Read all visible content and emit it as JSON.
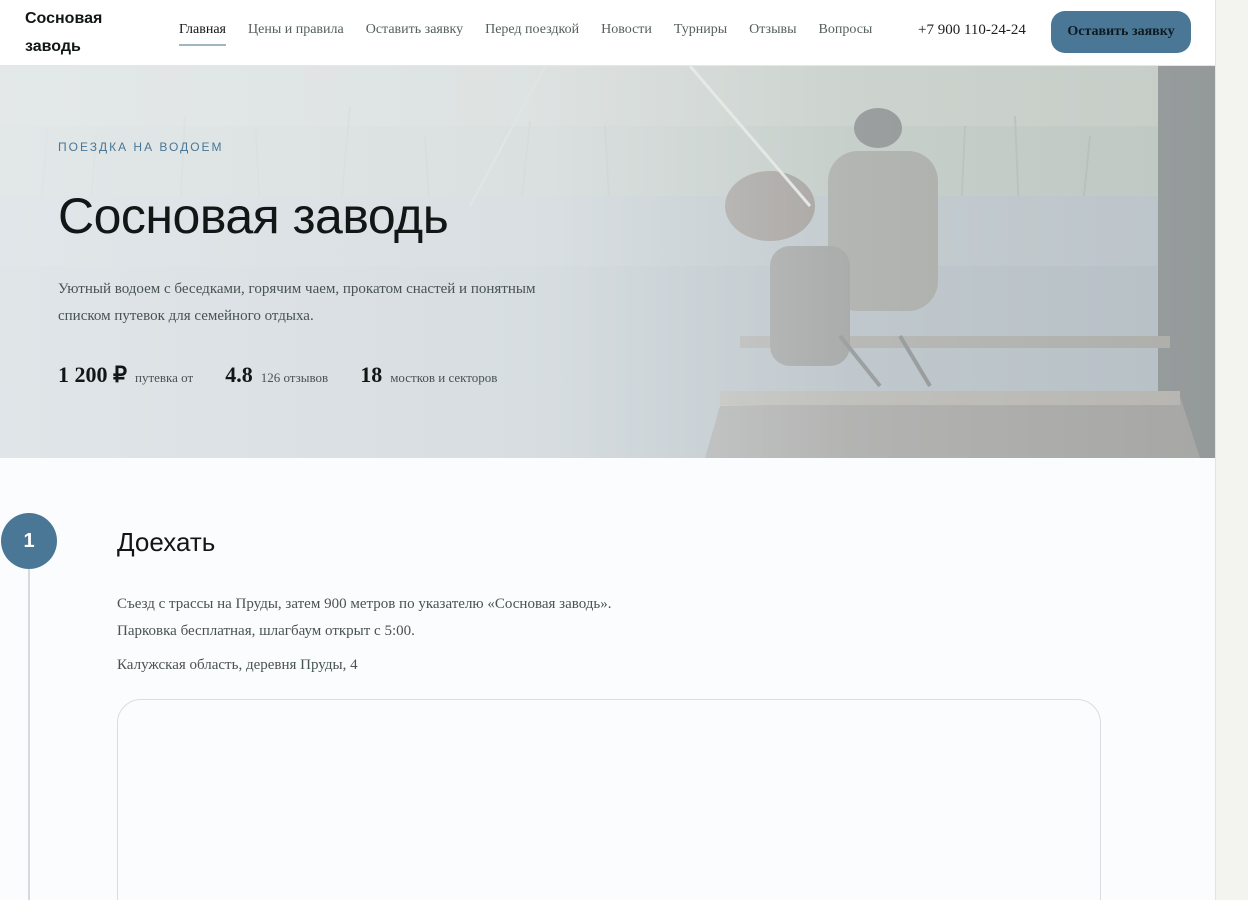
{
  "header": {
    "logo_line1": "Сосновая",
    "logo_line2": "заводь",
    "nav": [
      {
        "label": "Главная"
      },
      {
        "label": "Цены и правила"
      },
      {
        "label": "Оставить заявку"
      },
      {
        "label": "Перед поездкой"
      },
      {
        "label": "Новости"
      },
      {
        "label": "Турниры"
      },
      {
        "label": "Отзывы"
      },
      {
        "label": "Вопросы"
      }
    ],
    "active_nav": "Главная",
    "phone": "+7 900 110-24-24",
    "cta_label": "Оставить заявку"
  },
  "hero": {
    "eyebrow": "Поездка на водоем",
    "title": "Сосновая заводь",
    "description_line1": "Уютный водоем с беседками, горячим чаем, прокатом снастей и понятным",
    "description_line2": "списком путевок для семейного отдыха.",
    "stats": [
      {
        "value": "1 200 ₽",
        "label": "путевка от"
      },
      {
        "value": "4.8",
        "label": "126 отзывов"
      },
      {
        "value": "18",
        "label": "мостков и секторов"
      }
    ],
    "image_icon": "fisherman-photo"
  },
  "step": {
    "number": "1",
    "title": "Доехать",
    "text_line1": "Съезд с трассы на Пруды, затем 900 метров по указателю «Сосновая заводь».",
    "text_line2": "Парковка бесплатная, шлагбаум открыт с 5:00.",
    "address": "Калужская область, деревня Пруды, 4"
  },
  "colors": {
    "accent": "#4a7795",
    "text": "#121616",
    "muted": "#495352",
    "background": "#fbfcfe"
  }
}
